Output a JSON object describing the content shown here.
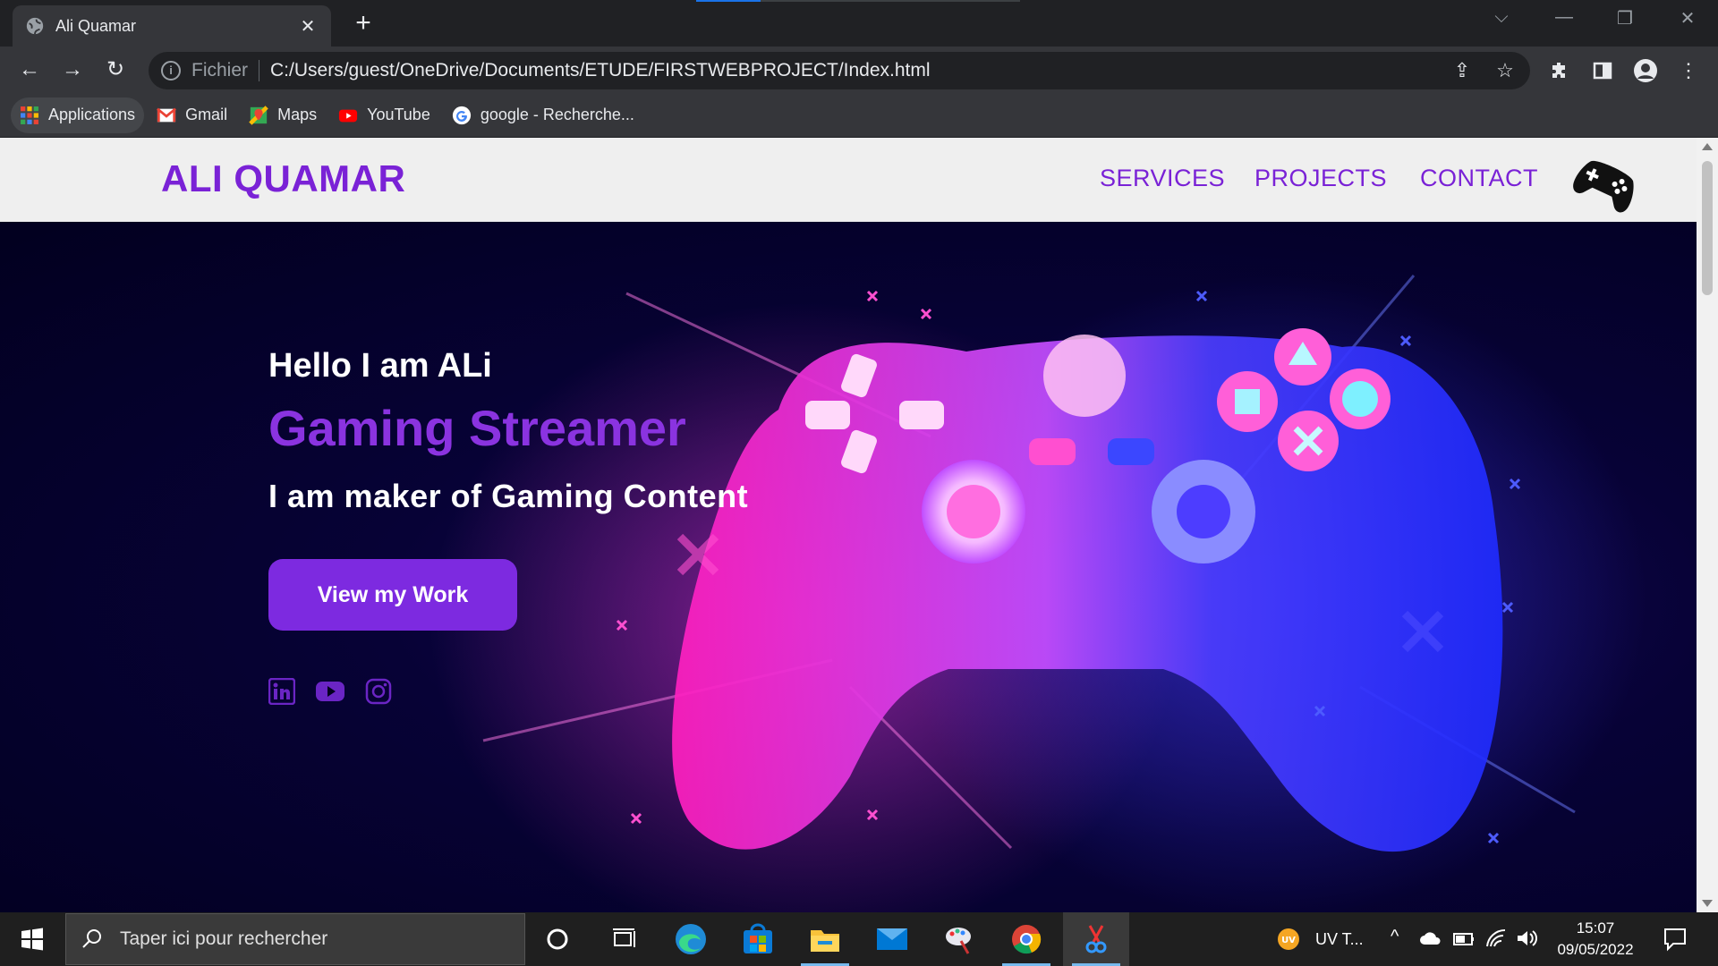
{
  "browser": {
    "tab_title": "Ali Quamar",
    "scheme_label": "Fichier",
    "url": "C:/Users/guest/OneDrive/Documents/ETUDE/FIRSTWEBPROJECT/Index.html",
    "bookmarks": [
      {
        "label": "Applications",
        "icon": "apps-grid-icon"
      },
      {
        "label": "Gmail",
        "icon": "gmail-icon"
      },
      {
        "label": "Maps",
        "icon": "maps-icon"
      },
      {
        "label": "YouTube",
        "icon": "youtube-icon"
      },
      {
        "label": "google - Recherche...",
        "icon": "google-icon"
      }
    ]
  },
  "site": {
    "brand": "ALI QUAMAR",
    "nav": [
      "SERVICES",
      "PROJECTS",
      "CONTACT"
    ],
    "hero": {
      "hello": "Hello I am ALi",
      "role": "Gaming Streamer",
      "tagline": "I am maker of Gaming Content",
      "cta": "View my Work"
    },
    "social": [
      "linkedin-icon",
      "youtube-icon",
      "instagram-icon"
    ],
    "colors": {
      "accent": "#7a22d6",
      "hero_bg": "#03012b",
      "header_bg": "#efefef"
    }
  },
  "taskbar": {
    "search_placeholder": "Taper ici pour rechercher",
    "weather_label": "UV T...",
    "time": "15:07",
    "date": "09/05/2022"
  }
}
